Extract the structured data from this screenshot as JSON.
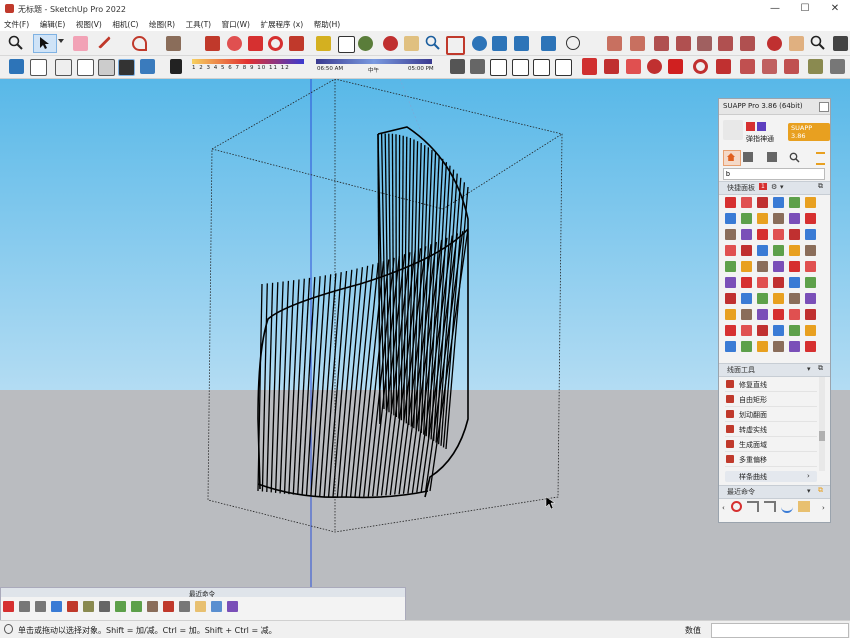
{
  "window": {
    "title": "无标题 - SketchUp Pro 2022",
    "minimize": "—",
    "maximize": "☐",
    "close": "✕"
  },
  "menu": [
    "文件(F)",
    "编辑(E)",
    "视图(V)",
    "相机(C)",
    "绘图(R)",
    "工具(T)",
    "窗口(W)",
    "扩展程序 (x)",
    "帮助(H)"
  ],
  "shadow": {
    "months": "1 2 3 4 5 6 7 8 9 10 11 12",
    "time_start": "06:50 AM",
    "time_mid": "中午",
    "time_end": "05:00 PM"
  },
  "suapp": {
    "title": "SUAPP Pro 3.86 (64bit)",
    "badge": "SUAPP 3.86",
    "username": "弹指神通",
    "search_value": "b",
    "quick_panel_title": "快捷面板",
    "quick_panel_count": "1",
    "line_tools_title": "线面工具",
    "tools": [
      "修复直线",
      "自由矩形",
      "划动翻面",
      "转虚实线",
      "生成面域",
      "多重偏移"
    ],
    "sub_section": "样条曲线",
    "recent_title": "最近命令"
  },
  "recent_toolbar": {
    "title": "最近命令"
  },
  "status": {
    "hint": "单击或拖动以选择对象。Shift = 加/减。Ctrl = 加。Shift + Ctrl = 减。",
    "measure_label": "数值",
    "measure_value": ""
  },
  "colors": {
    "accent": "#e8a020",
    "sky_top": "#58b8e8",
    "ground": "#babcc0",
    "red": "#c0392b"
  }
}
